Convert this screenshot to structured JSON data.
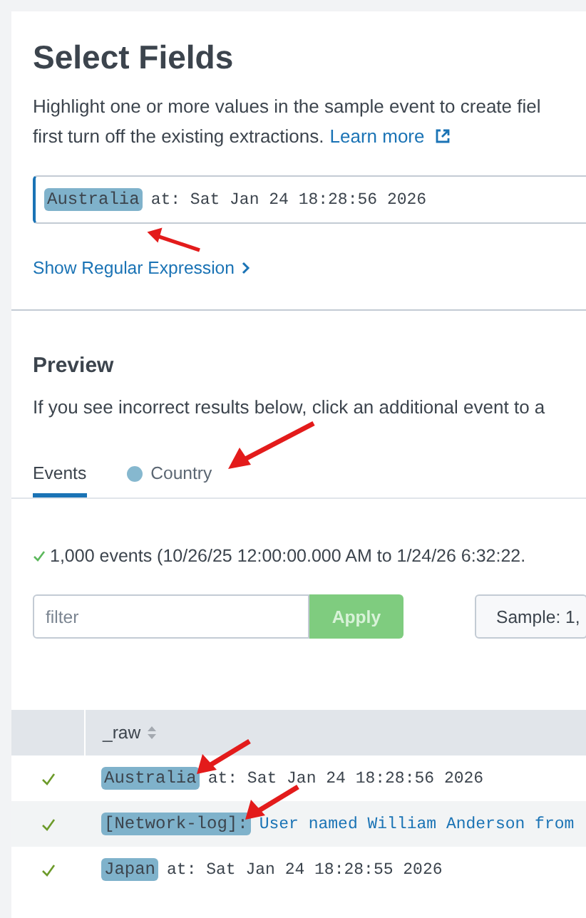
{
  "title": "Select Fields",
  "intro": {
    "lines": [
      "Highlight one or more values in the sample event to create fiel",
      "first turn off the existing extractions."
    ],
    "link": "Learn more"
  },
  "sample_event": {
    "highlight": "Australia",
    "rest": "at: Sat Jan 24 18:28:56 2026"
  },
  "regex_toggle": {
    "label": "Show Regular Expression",
    "expanded": false
  },
  "preview": {
    "title": "Preview",
    "description": "If you see incorrect results below, click an additional event to a"
  },
  "tabs": [
    {
      "label": "Events",
      "selected": true
    },
    {
      "label": "Country",
      "selected": false,
      "color": "#86b8cf"
    }
  ],
  "event_count": "1,000 events (10/26/25 12:00:00.000 AM to 1/24/26 6:32:22.",
  "filter": {
    "placeholder": "filter",
    "button": "Apply",
    "disabled": true
  },
  "sample_button": "Sample: 1,",
  "table": {
    "columns": [
      "_raw"
    ],
    "rows": [
      {
        "matched": true,
        "highlight": "Australia",
        "rest": "at: Sat Jan 24 18:28:56 2026",
        "rest_linked": false
      },
      {
        "matched": true,
        "highlight": "[Network-log]:",
        "rest": "User named William Anderson from",
        "rest_linked": true
      },
      {
        "matched": true,
        "highlight": "Japan",
        "rest": "at: Sat Jan 24 18:28:55 2026",
        "rest_linked": false
      }
    ]
  }
}
